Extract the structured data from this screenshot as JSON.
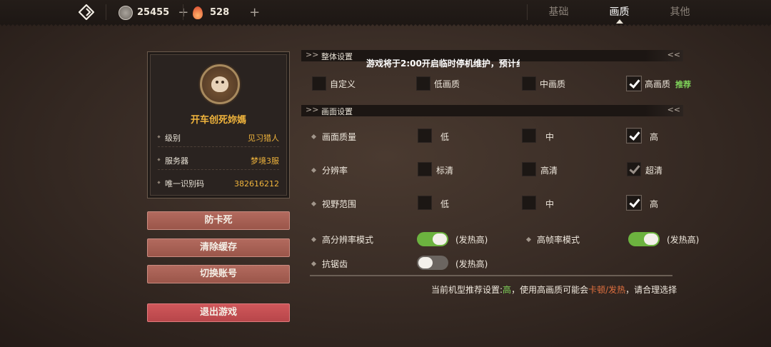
{
  "topbar": {
    "silver_count": "25455",
    "fire_count": "528",
    "plus_symbol": "+",
    "tabs": [
      "基础",
      "画质",
      "其他"
    ],
    "active_tab": "画质"
  },
  "profile": {
    "name": "开车创死妳媽",
    "rows": [
      {
        "key": "级别",
        "value": "见习猎人"
      },
      {
        "key": "服务器",
        "value": "梦境3服"
      },
      {
        "key": "唯一识别码",
        "value": "382616212"
      }
    ]
  },
  "buttons": {
    "anti_stuck": "防卡死",
    "clear_cache": "清除缓存",
    "switch_account": "切换账号",
    "exit_game": "退出游戏"
  },
  "overall": {
    "title": "整体设置",
    "notice": "游戏将于2:00开启临时停机维护，预计纟",
    "options": [
      {
        "label": "自定义",
        "checked": false
      },
      {
        "label": "低画质",
        "checked": false
      },
      {
        "label": "中画质",
        "checked": false
      },
      {
        "label": "高画质",
        "checked": true
      }
    ],
    "recommend": "推荐"
  },
  "picture": {
    "title": "画面设置",
    "rows": [
      {
        "label": "画面质量",
        "options": [
          {
            "label": "低",
            "checked": false
          },
          {
            "label": "中",
            "checked": false
          },
          {
            "label": "高",
            "checked": true
          }
        ]
      },
      {
        "label": "分辨率",
        "options": [
          {
            "label": "标清",
            "checked": false
          },
          {
            "label": "高清",
            "checked": false
          },
          {
            "label": "超清",
            "checked": true
          }
        ]
      },
      {
        "label": "视野范围",
        "options": [
          {
            "label": "低",
            "checked": false
          },
          {
            "label": "中",
            "checked": false
          },
          {
            "label": "高",
            "checked": true
          }
        ]
      }
    ],
    "toggles": [
      {
        "label": "高分辨率模式",
        "on": true,
        "hint": "(发热高)"
      },
      {
        "label": "高帧率模式",
        "on": true,
        "hint": "(发热高)"
      },
      {
        "label": "抗锯齿",
        "on": false,
        "hint": "(发热高)"
      }
    ]
  },
  "footer": {
    "prefix": "当前机型推荐设置:",
    "level": "高",
    "middle": "，使用高画质可能会",
    "warn": "卡顿/发热",
    "suffix": "，请合理选择"
  },
  "colors": {
    "accent_gold": "#f0b43c",
    "green": "#6cb33f",
    "warn_orange": "#e0703f"
  }
}
